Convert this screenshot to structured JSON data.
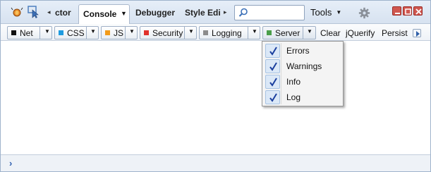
{
  "toolbar": {
    "tabs": {
      "partial_left": "ctor",
      "active": "Console",
      "debugger": "Debugger",
      "style_editor": "Style Edi"
    },
    "search": {
      "value": "",
      "placeholder": ""
    },
    "tools_label": "Tools"
  },
  "filters": {
    "net": {
      "label": "Net",
      "color": "#111111"
    },
    "css": {
      "label": "CSS",
      "color": "#1f9bdf"
    },
    "js": {
      "label": "JS",
      "color": "#f29b1a"
    },
    "security": {
      "label": "Security",
      "color": "#e0322d"
    },
    "logging": {
      "label": "Logging",
      "color": "#8c8c8c"
    },
    "server": {
      "label": "Server",
      "color": "#4a9e4a"
    },
    "clear": "Clear",
    "jquerify": "jQuerify",
    "persist": "Persist"
  },
  "server_menu": {
    "items": [
      {
        "label": "Errors",
        "checked": true
      },
      {
        "label": "Warnings",
        "checked": true
      },
      {
        "label": "Info",
        "checked": true
      },
      {
        "label": "Log",
        "checked": true
      }
    ]
  },
  "command_line": {
    "prompt": "›"
  }
}
